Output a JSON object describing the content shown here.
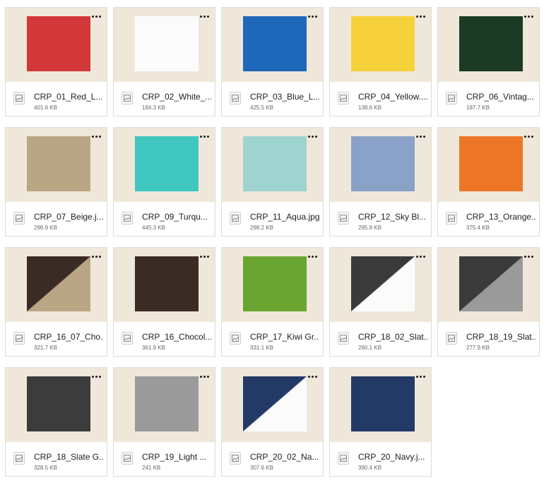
{
  "files": [
    {
      "name": "CRP_01_Red_L...",
      "size": "401.6 KB",
      "swatch": {
        "type": "solid",
        "color1": "#d2373a"
      }
    },
    {
      "name": "CRP_02_White_...",
      "size": "184.3 KB",
      "swatch": {
        "type": "solid",
        "color1": "#fbfbfb"
      }
    },
    {
      "name": "CRP_03_Blue_L...",
      "size": "425.5 KB",
      "swatch": {
        "type": "solid",
        "color1": "#1f67b8"
      }
    },
    {
      "name": "CRP_04_Yellow....",
      "size": "138.6 KB",
      "swatch": {
        "type": "solid",
        "color1": "#f6d13b"
      }
    },
    {
      "name": "CRP_06_Vintag...",
      "size": "187.7 KB",
      "swatch": {
        "type": "solid",
        "color1": "#1c3b26"
      }
    },
    {
      "name": "CRP_07_Beige.j...",
      "size": "296.9 KB",
      "swatch": {
        "type": "solid",
        "color1": "#b9a684"
      }
    },
    {
      "name": "CRP_09_Turqu...",
      "size": "445.3 KB",
      "swatch": {
        "type": "solid",
        "color1": "#3fc7c0"
      }
    },
    {
      "name": "CRP_11_Aqua.jpg",
      "size": "298.2 KB",
      "swatch": {
        "type": "solid",
        "color1": "#9fd3cf"
      }
    },
    {
      "name": "CRP_12_Sky Bl...",
      "size": "295.9 KB",
      "swatch": {
        "type": "solid",
        "color1": "#8aa1c8"
      }
    },
    {
      "name": "CRP_13_Orange...",
      "size": "375.4 KB",
      "swatch": {
        "type": "solid",
        "color1": "#ec7626"
      }
    },
    {
      "name": "CRP_16_07_Cho...",
      "size": "321.7 KB",
      "swatch": {
        "type": "diagonal",
        "color1": "#3a2c25",
        "color2": "#b9a684"
      }
    },
    {
      "name": "CRP_16_Chocol...",
      "size": "361.9 KB",
      "swatch": {
        "type": "solid",
        "color1": "#3a2c25"
      }
    },
    {
      "name": "CRP_17_Kiwi Gr...",
      "size": "331.1 KB",
      "swatch": {
        "type": "solid",
        "color1": "#6aa532"
      }
    },
    {
      "name": "CRP_18_02_Slat...",
      "size": "260.1 KB",
      "swatch": {
        "type": "diagonal",
        "color1": "#3a3a3b",
        "color2": "#fbfbfb"
      }
    },
    {
      "name": "CRP_18_19_Slat...",
      "size": "277.9 KB",
      "swatch": {
        "type": "diagonal",
        "color1": "#3a3a3b",
        "color2": "#9a9a9a"
      }
    },
    {
      "name": "CRP_18_Slate G...",
      "size": "328.5 KB",
      "swatch": {
        "type": "solid",
        "color1": "#3c3c3d"
      }
    },
    {
      "name": "CRP_19_Light ...",
      "size": "241 KB",
      "swatch": {
        "type": "solid",
        "color1": "#9a9a9a"
      }
    },
    {
      "name": "CRP_20_02_Na...",
      "size": "307.6 KB",
      "swatch": {
        "type": "diagonal",
        "color1": "#233a66",
        "color2": "#fbfbfb"
      }
    },
    {
      "name": "CRP_20_Navy.j...",
      "size": "390.4 KB",
      "swatch": {
        "type": "solid",
        "color1": "#233a66"
      }
    }
  ],
  "icons": {
    "file": "image-file-icon",
    "more": "more-options-icon"
  }
}
